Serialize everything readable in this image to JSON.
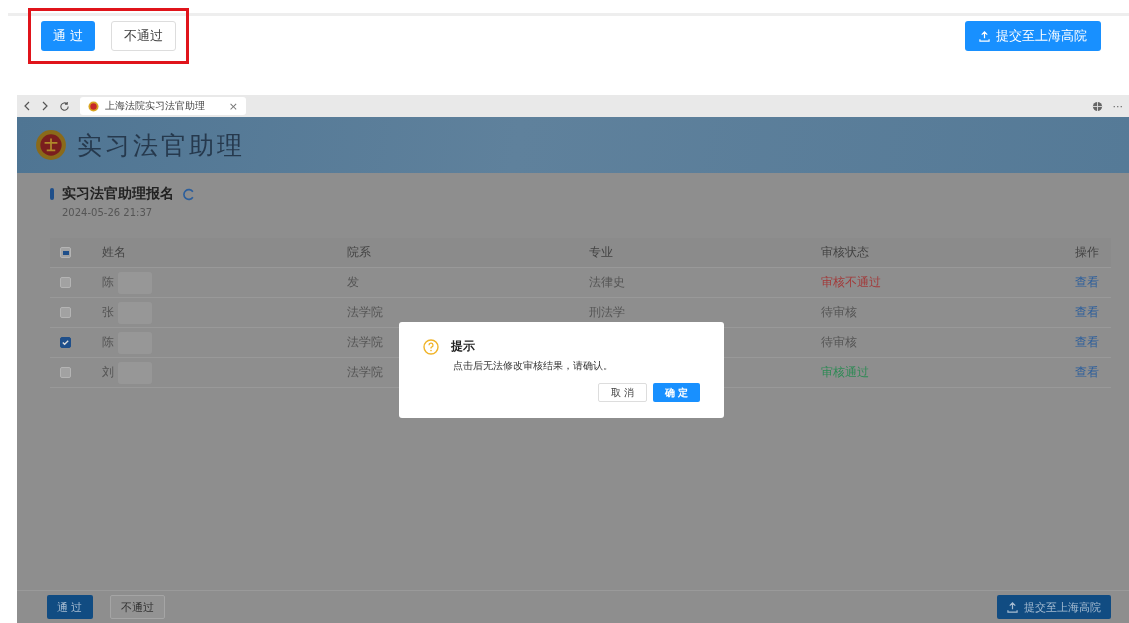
{
  "top_actions": {
    "highlighted": true,
    "approve": "通 过",
    "reject": "不通过",
    "submit": "提交至上海高院"
  },
  "browser": {
    "tab_title": "上海法院实习法官助理",
    "tab_close": "×",
    "more": "···"
  },
  "banner": {
    "title": "实习法官助理"
  },
  "section": {
    "title": "实习法官助理报名",
    "timestamp": "2024-05-26 21:37"
  },
  "table": {
    "select_all": {
      "indeterminate": true
    },
    "columns": [
      "姓名",
      "院系",
      "专业",
      "审核状态",
      "操作"
    ],
    "rows": [
      {
        "checked": false,
        "name": "陈",
        "department": "发",
        "major": "法律史",
        "status": "审核不通过",
        "color": "#a23a3a",
        "action": "查看"
      },
      {
        "checked": false,
        "name": "张",
        "department": "法学院",
        "major": "刑法学",
        "status": "待审核",
        "color": "#555555",
        "action": "查看"
      },
      {
        "checked": true,
        "name": "陈",
        "department": "法学院",
        "status": "待审核",
        "color": "#555555",
        "action": "查看"
      },
      {
        "checked": false,
        "name": "刘",
        "department": "法学院",
        "status": "审核通过",
        "color": "#2e8a55",
        "action": "查看"
      }
    ]
  },
  "dialog": {
    "title": "提示",
    "message": "点击后无法修改审核结果，请确认。",
    "cancel": "取 消",
    "confirm": "确 定"
  },
  "bottom_actions": {
    "approve": "通 过",
    "reject": "不通过",
    "submit": "提交至上海高院"
  }
}
